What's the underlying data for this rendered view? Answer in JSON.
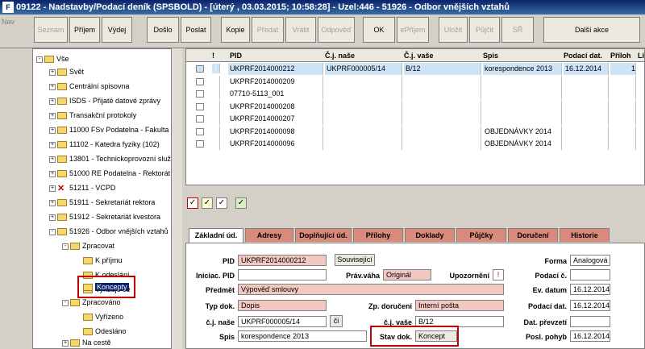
{
  "window": {
    "title": "09122 - Nadstavby/Podací deník (SPSBOLD) - [úterý , 03.03.2015; 10:58:28] - Uzel:446 - 51926 - Odbor vnějších vztahů",
    "icon_letter": "F"
  },
  "toolbar": {
    "nav": "Nav",
    "buttons": [
      "Seznam",
      "Příjem",
      "Výdej",
      "Došlo",
      "Poslat",
      "Kopie",
      "Předat",
      "Vrátit",
      "Odpověď",
      "OK",
      "ePříjem",
      "Uložit",
      "Půjčit",
      "SŘ",
      "Další akce"
    ]
  },
  "tree": {
    "items": [
      {
        "label": "Vše",
        "exp": "-",
        "icon": "folder"
      },
      {
        "label": "Svět",
        "exp": "+",
        "icon": "folder"
      },
      {
        "label": "Centrální spisovna",
        "exp": "+",
        "icon": "folder"
      },
      {
        "label": "ISDS - Přijaté datové zprávy",
        "exp": "+",
        "icon": "folder"
      },
      {
        "label": "Transakční protokoly",
        "exp": "+",
        "icon": "folder"
      },
      {
        "label": "11000 FSv Podatelna - Fakulta st",
        "exp": "+",
        "icon": "folder"
      },
      {
        "label": "11102 - Katedra fyziky (102)",
        "exp": "+",
        "icon": "folder"
      },
      {
        "label": "13801 - Technickoprovozní služ",
        "exp": "+",
        "icon": "folder"
      },
      {
        "label": "51000 RE Podatelna - Rektorát",
        "exp": "+",
        "icon": "folder"
      },
      {
        "label": "51211 - VCPD",
        "exp": "+",
        "icon": "x"
      },
      {
        "label": "51911 - Sekretariát rektora",
        "exp": "+",
        "icon": "folder"
      },
      {
        "label": "51912 - Sekretariát kvestora",
        "exp": "+",
        "icon": "folder"
      },
      {
        "label": "51926 - Odbor vnějších vztahů",
        "exp": "-",
        "icon": "folder"
      },
      {
        "label": "Zpracovat",
        "exp": "-",
        "icon": "folder"
      },
      {
        "label": "K příjmu",
        "exp": "",
        "icon": "folder"
      },
      {
        "label": "K odeslání",
        "exp": "",
        "icon": "folder"
      },
      {
        "label": "Vyřizuje se",
        "exp": "",
        "icon": "folder"
      },
      {
        "label": "Koncepty",
        "exp": "",
        "icon": "folder"
      },
      {
        "label": "Zpracováno",
        "exp": "-",
        "icon": "folder"
      },
      {
        "label": "Vyřízeno",
        "exp": "",
        "icon": "folder"
      },
      {
        "label": "Odesláno",
        "exp": "",
        "icon": "folder"
      },
      {
        "label": "Na cestě",
        "exp": "+",
        "icon": "folder"
      }
    ]
  },
  "grid": {
    "headers": [
      "!",
      "PID",
      "Č.j. naše",
      "Č.j. vaše",
      "Spis",
      "Podací dat.",
      "Příloh",
      "Lis"
    ],
    "rows": [
      {
        "pid": "UKPRF2014000212",
        "cj_nase": "UKPRF000005/14",
        "cj_vase": "B/12",
        "spis": "korespondence 2013",
        "podaci_dat": "16.12.2014",
        "prilohy": "1",
        "excl": "!"
      },
      {
        "pid": "UKPRF2014000209",
        "cj_nase": "",
        "cj_vase": "",
        "spis": "",
        "podaci_dat": "",
        "prilohy": "",
        "excl": ""
      },
      {
        "pid": "07710-5113_001",
        "cj_nase": "",
        "cj_vase": "",
        "spis": "",
        "podaci_dat": "",
        "prilohy": "",
        "excl": ""
      },
      {
        "pid": "UKPRF2014000208",
        "cj_nase": "",
        "cj_vase": "",
        "spis": "",
        "podaci_dat": "",
        "prilohy": "",
        "excl": ""
      },
      {
        "pid": "UKPRF2014000207",
        "cj_nase": "",
        "cj_vase": "",
        "spis": "",
        "podaci_dat": "",
        "prilohy": "",
        "excl": ""
      },
      {
        "pid": "UKPRF2014000098",
        "cj_nase": "",
        "cj_vase": "",
        "spis": "OBJEDNÁVKY 2014",
        "podaci_dat": "",
        "prilohy": "",
        "excl": ""
      },
      {
        "pid": "UKPRF2014000096",
        "cj_nase": "",
        "cj_vase": "",
        "spis": "OBJEDNÁVKY 2014",
        "podaci_dat": "",
        "prilohy": "",
        "excl": ""
      }
    ]
  },
  "tabs": [
    "Základní úd.",
    "Adresy",
    "Doplňující úd.",
    "Přílohy",
    "Doklady",
    "Půjčky",
    "Doručení",
    "Historie"
  ],
  "form": {
    "pid_label": "PID",
    "pid": "UKPRF2014000212",
    "souvisejici": "Související",
    "iniciac_label": "Iniciac. PID",
    "iniciac": "",
    "prav_vaha_label": "Práv.váha",
    "prav_vaha": "Originál",
    "upozorneni_label": "Upozornění",
    "upozorneni": "!",
    "predmet_label": "Předmět",
    "predmet": "Výpověď smlouvy",
    "typ_dok_label": "Typ dok.",
    "typ_dok": "Dopis",
    "zp_doruceni_label": "Zp. doručení",
    "zp_doruceni": "Interní pošta",
    "cj_nase_label": "č.j. naše",
    "cj_nase": "UKPRF000005/14",
    "ci_btn": "či",
    "cj_vase_label": "č.j. vaše",
    "cj_vase": "B/12",
    "spis_label": "Spis",
    "spis": "korespondence 2013",
    "stav_dok_label": "Stav dok.",
    "stav_dok": "Koncept",
    "forma_label": "Forma",
    "forma": "Analogová",
    "podaci_c_label": "Podací č.",
    "podaci_c": "",
    "ev_datum_label": "Ev. datum",
    "ev_datum": "16.12.2014",
    "podaci_dat_label": "Podací dat.",
    "podaci_dat": "16.12.2014",
    "dat_prevzeti_label": "Dat. převzetí",
    "dat_prevzeti": "",
    "posl_pohyb_label": "Posl. pohyb",
    "posl_pohyb": "16.12.2014"
  }
}
